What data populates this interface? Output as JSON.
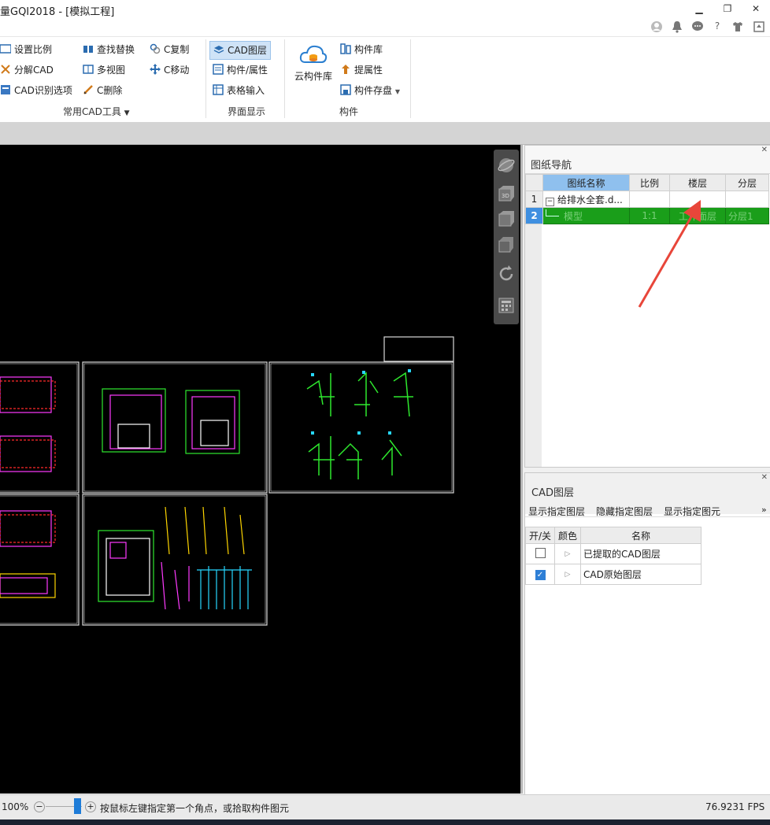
{
  "window": {
    "title": "量GQI2018 - [模拟工程]",
    "controls": {
      "minimize": "▁",
      "restore": "❐",
      "close": "✕"
    },
    "top_icons": [
      "user-icon",
      "bell-icon",
      "chat-icon",
      "help-icon",
      "shirt-icon",
      "upload-icon"
    ],
    "help_label": "?"
  },
  "ribbon": {
    "cad_tools": {
      "items": [
        "设置比例",
        "分解CAD",
        "CAD识别选项",
        "查找替换",
        "多视图",
        "C删除",
        "C复制",
        "C移动"
      ],
      "group_label": "常用CAD工具"
    },
    "display": {
      "items": [
        "CAD图层",
        "构件/属性",
        "表格输入"
      ],
      "group_label": "界面显示"
    },
    "component": {
      "cloud_label": "云构件库",
      "items": [
        "构件库",
        "提属性",
        "构件存盘"
      ],
      "group_label": "构件"
    }
  },
  "drawing_nav": {
    "title": "图纸导航",
    "columns": [
      "图纸名称",
      "比例",
      "楼层",
      "分层"
    ],
    "rows": [
      {
        "num": "1",
        "toggle": "−",
        "name": "给排水全套.d...",
        "scale": "",
        "floor": "",
        "layer": ""
      },
      {
        "num": "2",
        "toggle": "",
        "name": "模型",
        "scale": "1:1",
        "floor": "工作面层",
        "layer": "分层1"
      }
    ],
    "selected_color": "#1a9e1a"
  },
  "cad_layers": {
    "title": "CAD图层",
    "actions": [
      "显示指定图层",
      "隐藏指定图层",
      "显示指定图元"
    ],
    "more": "»",
    "columns": [
      "开/关",
      "颜色",
      "名称"
    ],
    "rows": [
      {
        "checked": false,
        "name": "已提取的CAD图层"
      },
      {
        "checked": true,
        "name": "CAD原始图层"
      }
    ]
  },
  "status": {
    "zoom": "100%",
    "hint": "按鼠标左键指定第一个角点，或拾取构件图元",
    "fps": "76.9231 FPS"
  },
  "accent_colors": {
    "ribbon_selected": "#cfe3f7",
    "header_blue": "#8fc0ee",
    "arrow": "#e8463a"
  }
}
